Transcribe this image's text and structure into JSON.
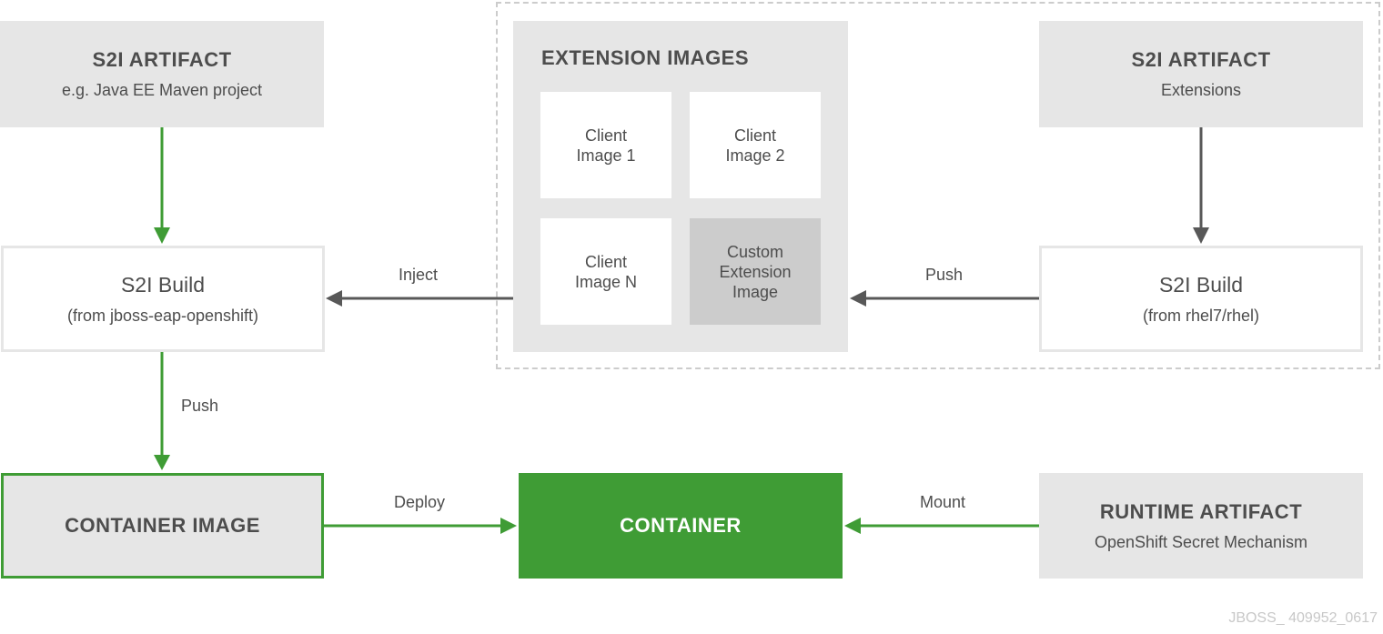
{
  "colors": {
    "green": "#3f9c35",
    "gray_box": "#e6e6e6",
    "dark_arrow": "#585858",
    "custom_ext": "#cccccc",
    "text": "#4d4d4d"
  },
  "nodes": {
    "s2i_artifact_left": {
      "title": "S2I ARTIFACT",
      "subtitle": "e.g. Java EE Maven project"
    },
    "s2i_build_left": {
      "title": "S2I Build",
      "subtitle": "(from jboss-eap-openshift)"
    },
    "container_image": {
      "title": "CONTAINER IMAGE"
    },
    "container": {
      "title": "CONTAINER"
    },
    "extension_images": {
      "title": "EXTENSION IMAGES",
      "items": [
        {
          "label": "Client\nImage 1"
        },
        {
          "label": "Client\nImage 2"
        },
        {
          "label": "Client\nImage N"
        },
        {
          "label": "Custom\nExtension\nImage"
        }
      ]
    },
    "s2i_artifact_right": {
      "title": "S2I ARTIFACT",
      "subtitle": "Extensions"
    },
    "s2i_build_right": {
      "title": "S2I Build",
      "subtitle": "(from rhel7/rhel)"
    },
    "runtime_artifact": {
      "title": "RUNTIME ARTIFACT",
      "subtitle": "OpenShift Secret Mechanism"
    }
  },
  "edges": {
    "inject": "Inject",
    "push_right": "Push",
    "push_left": "Push",
    "deploy": "Deploy",
    "mount": "Mount"
  },
  "footer": "JBOSS_ 409952_0617"
}
